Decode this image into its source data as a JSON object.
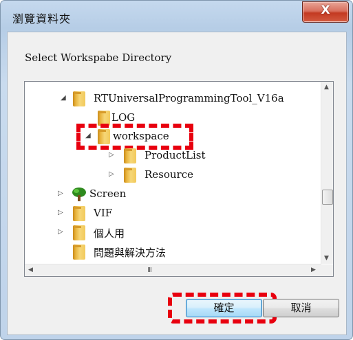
{
  "window": {
    "title": "瀏覽資料夾",
    "close_glyph": "X"
  },
  "dialog": {
    "prompt": "Select Workspabe Directory"
  },
  "tree": {
    "nodes": {
      "root": {
        "label": "RTUniversalProgrammingTool_V16a",
        "expanded": true
      },
      "log": {
        "label": "LOG"
      },
      "workspace": {
        "label": "workspace",
        "expanded": true,
        "selected": true
      },
      "productlist": {
        "label": "ProductList"
      },
      "resource": {
        "label": "Resource"
      },
      "screen": {
        "label": "Screen"
      },
      "vif": {
        "label": "VIF"
      },
      "personal": {
        "label": "個人用"
      },
      "qa": {
        "label": "問題與解決方法"
      }
    },
    "hscroll_grip": "III"
  },
  "buttons": {
    "ok": "確定",
    "cancel": "取消"
  },
  "colors": {
    "highlight": "#e8000e",
    "close_button": "#c33a22",
    "ok_button": "#bee6fd"
  }
}
